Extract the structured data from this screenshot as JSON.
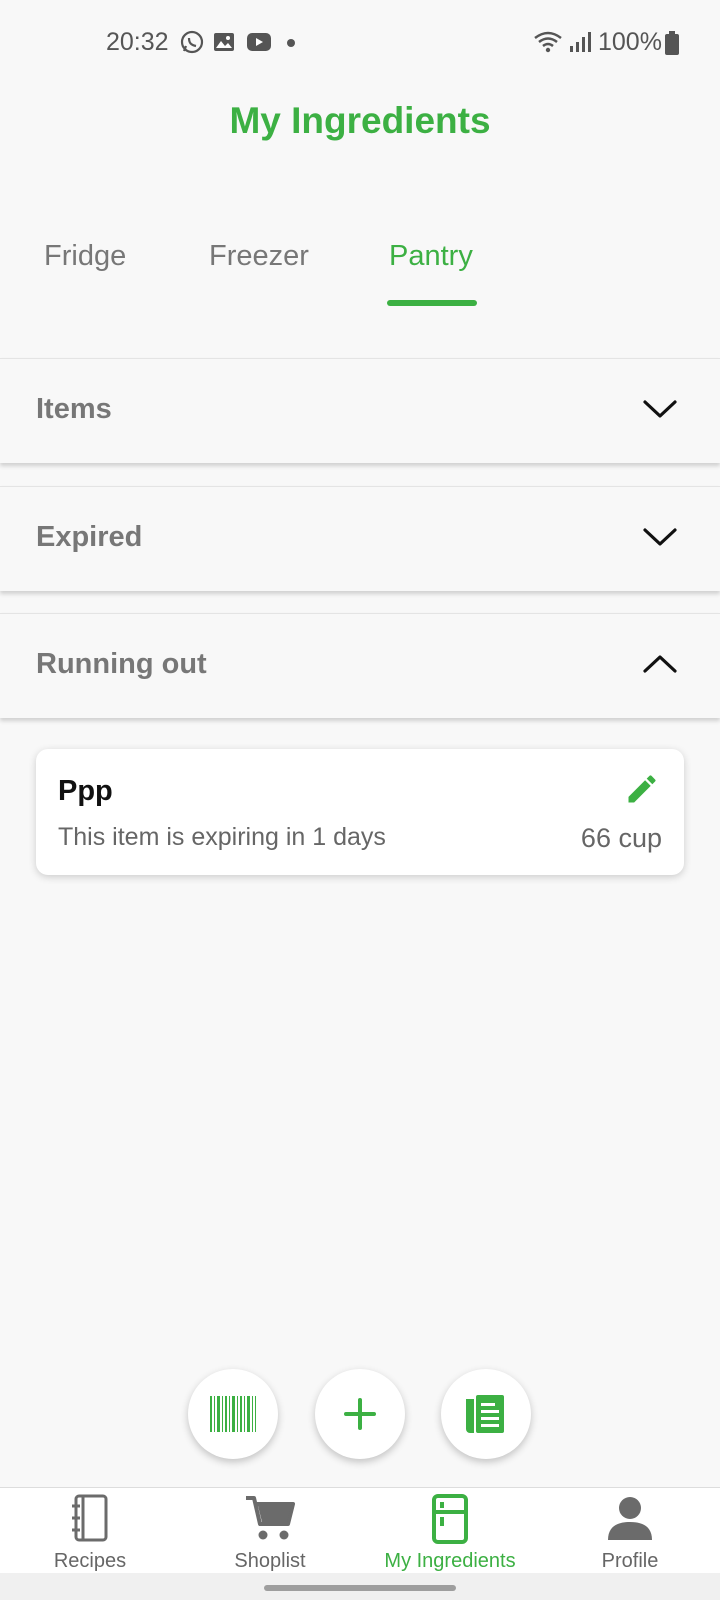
{
  "status_bar": {
    "time": "20:32",
    "left_icons": [
      "whatsapp-icon",
      "gallery-icon",
      "youtube-icon",
      "dot-icon"
    ],
    "right_icons": [
      "wifi-icon",
      "signal-icon",
      "battery-icon"
    ],
    "battery": "100%"
  },
  "header": {
    "title": "My Ingredients"
  },
  "tabs": [
    {
      "label": "Fridge",
      "active": false
    },
    {
      "label": "Freezer",
      "active": false
    },
    {
      "label": "Pantry",
      "active": true
    }
  ],
  "sections": [
    {
      "label": "Items",
      "expanded": false
    },
    {
      "label": "Expired",
      "expanded": false
    },
    {
      "label": "Running out",
      "expanded": true
    }
  ],
  "items": [
    {
      "name": "Ppp",
      "subtitle": "This item is expiring in 1 days",
      "quantity": "66 cup",
      "action_icon": "edit-icon"
    }
  ],
  "fabs": [
    "barcode-icon",
    "plus-icon",
    "receipt-icon"
  ],
  "bottom_nav": [
    {
      "label": "Recipes",
      "icon": "notebook-icon",
      "active": false
    },
    {
      "label": "Shoplist",
      "icon": "cart-icon",
      "active": false
    },
    {
      "label": "My Ingredients",
      "icon": "fridge-icon",
      "active": true
    },
    {
      "label": "Profile",
      "icon": "person-icon",
      "active": false
    }
  ],
  "colors": {
    "accent": "#3cb043",
    "background": "#f8f8f8",
    "muted_text": "#777777"
  }
}
